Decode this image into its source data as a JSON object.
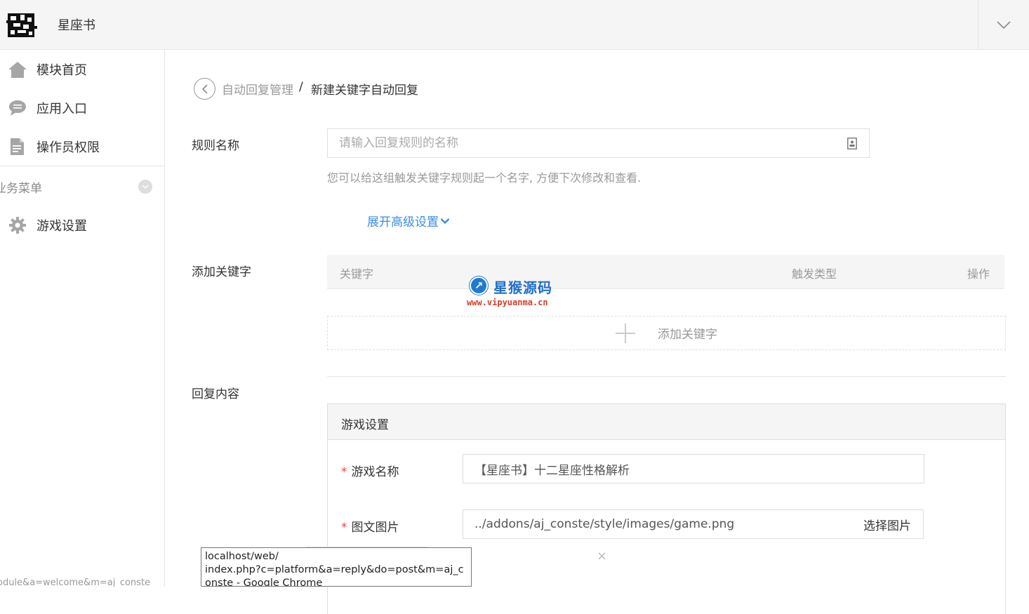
{
  "header": {
    "app_title": "星座书"
  },
  "sidebar": {
    "items": [
      {
        "label": "模块首页",
        "icon": "home-icon"
      },
      {
        "label": "应用入口",
        "icon": "chat-icon"
      },
      {
        "label": "操作员权限",
        "icon": "document-icon"
      }
    ],
    "group_title": "业务菜单",
    "group_items": [
      {
        "label": "游戏设置",
        "icon": "gear-icon"
      }
    ],
    "status_text": "odule&a=welcome&m=aj_conste"
  },
  "breadcrumb": {
    "parent": "自动回复管理",
    "separator": "/",
    "current": "新建关键字自动回复"
  },
  "form": {
    "rule_name": {
      "label": "规则名称",
      "placeholder": "请输入回复规则的名称",
      "value": "",
      "help": "您可以给这组触发关键字规则起一个名字, 方便下次修改和查看."
    },
    "advanced_link": "展开高级设置",
    "keywords": {
      "label": "添加关键字",
      "columns": [
        "关键字",
        "触发类型",
        "操作"
      ],
      "rows": [],
      "add_label": "添加关键字"
    },
    "reply": {
      "label": "回复内容",
      "panel_title": "游戏设置",
      "game_name_label": "游戏名称",
      "game_name_value": "【星座书】十二星座性格解析",
      "image_label": "图文图片",
      "image_value": "../addons/aj_conste/style/images/game.png",
      "select_image_label": "选择图片",
      "required_mark": "*",
      "remove_mark": "×"
    }
  },
  "watermark": {
    "title": "星猴源码",
    "url": "www.vipyuanma.cn"
  },
  "tooltip": {
    "line1": "localhost/web/",
    "line2": "index.php?c=platform&a=reply&do=post&m=aj_c",
    "line3": "onste - Google Chrome"
  },
  "colors": {
    "link": "#3a8ee6",
    "required": "#e54545",
    "header_bg": "#f5f5f5"
  }
}
